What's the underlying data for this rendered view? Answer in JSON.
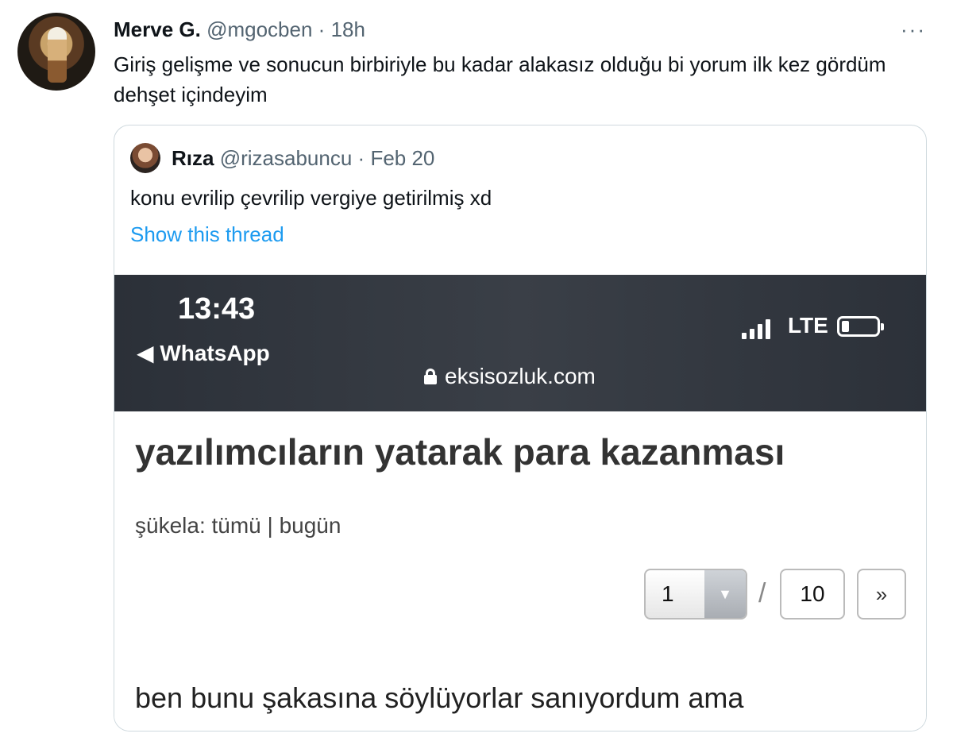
{
  "tweet": {
    "name": "Merve G.",
    "handle": "@mgocben",
    "separator": "·",
    "time": "18h",
    "more": "···",
    "text": "Giriş gelişme ve sonucun birbiriyle bu kadar alakasız olduğu bi yorum ilk kez gördüm dehşet içindeyim"
  },
  "quote": {
    "name": "Rıza",
    "handle": "@rizasabuncu",
    "separator": "·",
    "time": "Feb 20",
    "text": "konu evrilip çevrilip vergiye getirilmiş xd",
    "show_thread": "Show this thread"
  },
  "screenshot": {
    "clock": "13:43",
    "back_label": "◀ WhatsApp",
    "network": "LTE",
    "url": "eksisozluk.com",
    "title": "yazılımcıların yatarak para kazanması",
    "filter_label": "şükela:",
    "filter_all": "tümü",
    "filter_sep": "|",
    "filter_today": "bugün",
    "page_current": "1",
    "page_slash": "/",
    "page_total": "10",
    "page_next": "»",
    "entry_text": "ben bunu şakasına söylüyorlar sanıyordum ama"
  }
}
